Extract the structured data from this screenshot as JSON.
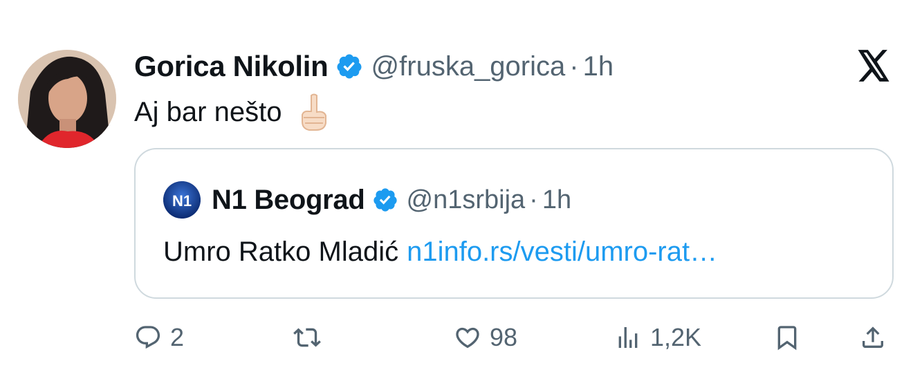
{
  "tweet": {
    "author": {
      "display_name": "Gorica Nikolin",
      "handle": "@fruska_gorica",
      "verified": true
    },
    "separator": "·",
    "time": "1h",
    "text": "Aj bar nešto",
    "emoji": "pointing-up-emoji"
  },
  "quote": {
    "author": {
      "display_name": "N1 Beograd",
      "handle": "@n1srbija",
      "verified": true,
      "avatar_label": "N1"
    },
    "separator": "·",
    "time": "1h",
    "text": "Umro Ratko Mladić",
    "link": "n1info.rs/vesti/umro-rat…"
  },
  "actions": {
    "reply": {
      "icon": "reply-icon",
      "count": "2"
    },
    "retweet": {
      "icon": "retweet-icon",
      "count": ""
    },
    "like": {
      "icon": "heart-icon",
      "count": "98"
    },
    "views": {
      "icon": "views-icon",
      "count": "1,2K"
    },
    "bookmark": {
      "icon": "bookmark-icon"
    },
    "share": {
      "icon": "share-icon"
    }
  },
  "colors": {
    "text": "#0f1419",
    "secondary": "#536471",
    "accent": "#1d9bf0",
    "border": "#cfd9de"
  }
}
